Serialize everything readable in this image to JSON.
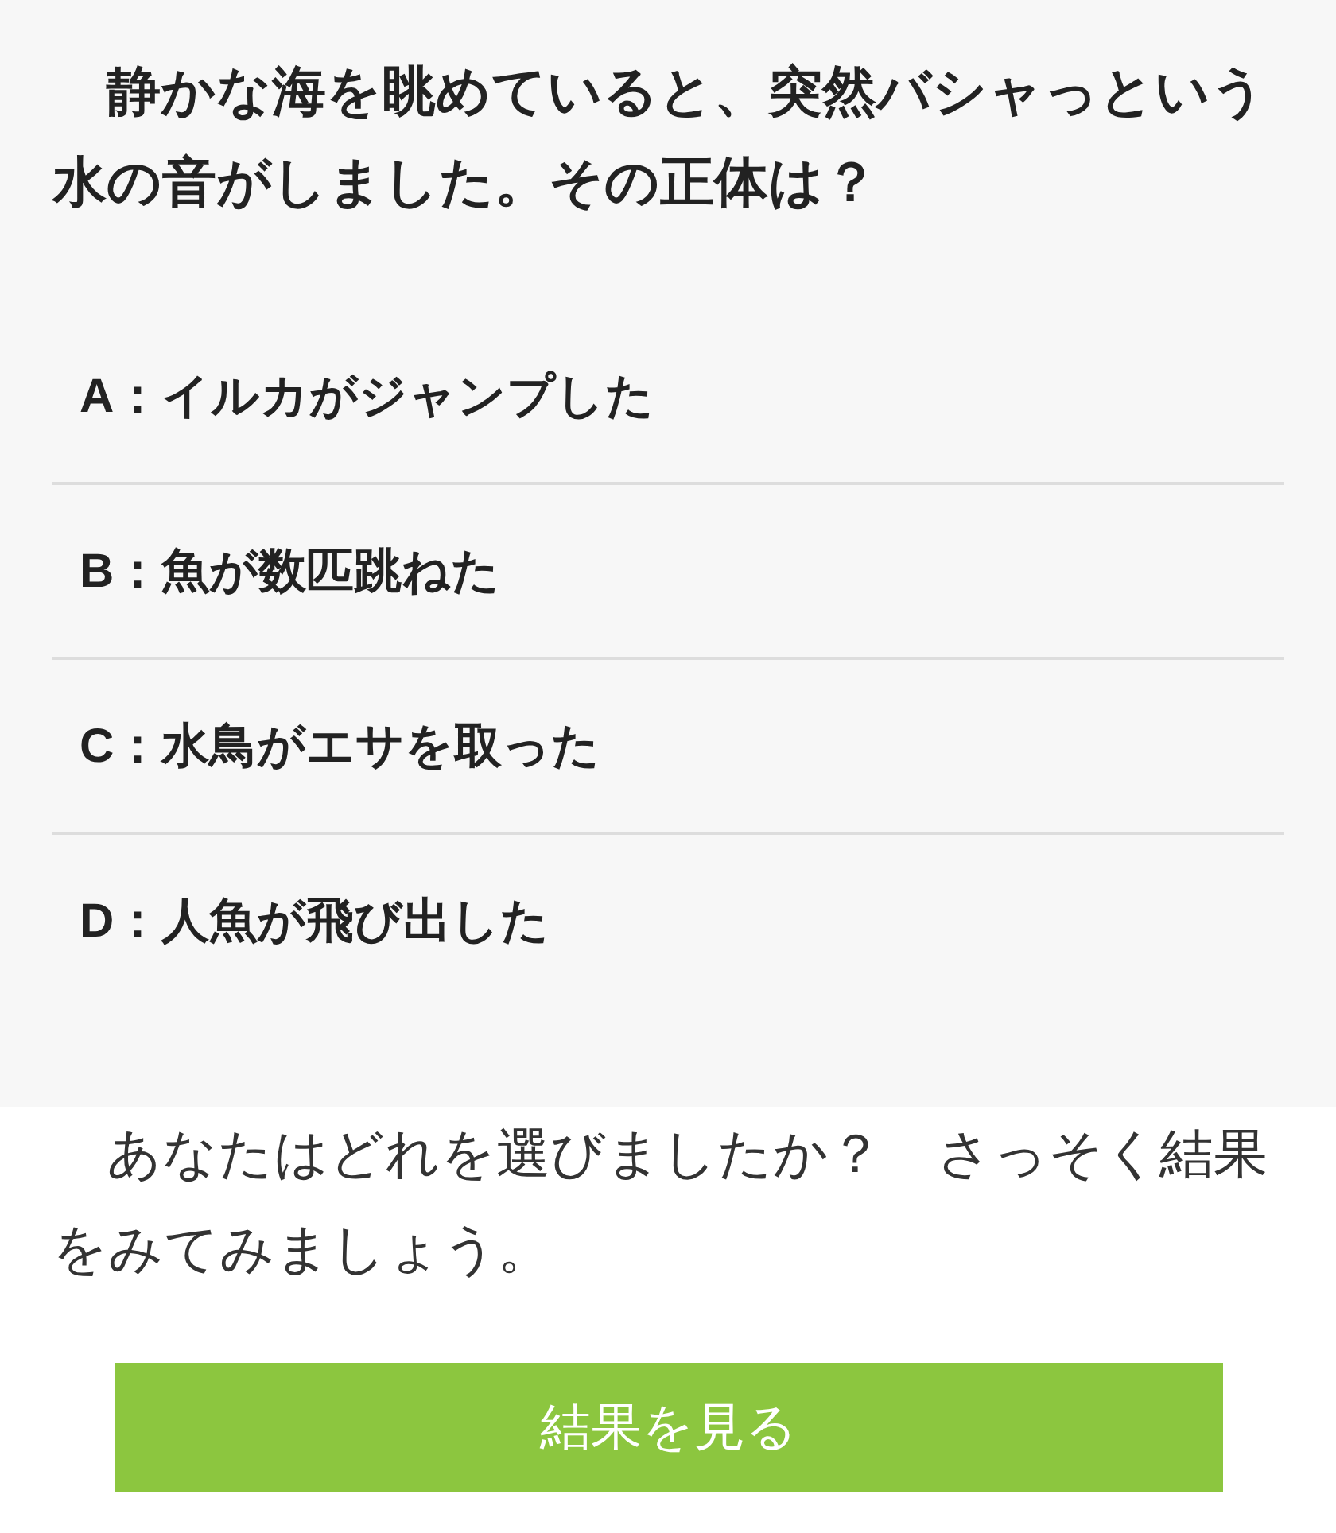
{
  "question": "　静かな海を眺めていると、突然バシャっという水の音がしました。その正体は？",
  "options": [
    {
      "label": "A：イルカがジャンプした"
    },
    {
      "label": "B：魚が数匹跳ねた"
    },
    {
      "label": "C：水鳥がエサを取った"
    },
    {
      "label": "D：人魚が飛び出した"
    }
  ],
  "prompt": "　あなたはどれを選びましたか？　さっそく結果をみてみましょう。",
  "button": "結果を見る"
}
